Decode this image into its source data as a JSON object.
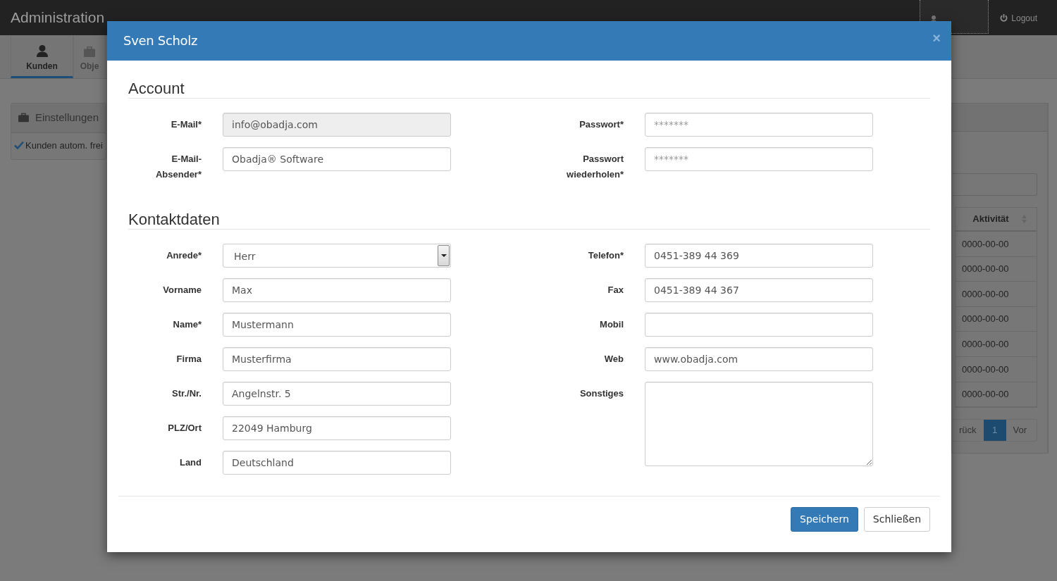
{
  "navbar": {
    "brand": "Administration",
    "logout": "Logout"
  },
  "tabs": [
    {
      "label": "Kunden",
      "selected": true
    },
    {
      "label": "Obje",
      "selected": false
    }
  ],
  "settings_panel": {
    "title": "Einstellungen",
    "options": [
      {
        "label": "Kunden autom. frei",
        "checked": true
      }
    ]
  },
  "table": {
    "columns": [
      "Aktivität"
    ],
    "rows": [
      [
        "0000-00-00"
      ],
      [
        "0000-00-00"
      ],
      [
        "0000-00-00"
      ],
      [
        "0000-00-00"
      ],
      [
        "0000-00-00"
      ],
      [
        "0000-00-00"
      ],
      [
        "0000-00-00"
      ]
    ]
  },
  "pagination": [
    {
      "label": "rück",
      "selected": false
    },
    {
      "label": "1",
      "selected": true
    },
    {
      "label": "Vor",
      "selected": false
    }
  ],
  "modal": {
    "title": "Sven Scholz",
    "close": "×",
    "sections": [
      {
        "title": "Account",
        "left": [
          {
            "label": "E-Mail*",
            "kind": "text",
            "value": "info@obadja.com",
            "disabled": true
          },
          {
            "label": "E-Mail-Absender*",
            "kind": "text",
            "value": "Obadja® Software",
            "disabled": false
          }
        ],
        "right": [
          {
            "label": "Passwort*",
            "kind": "password",
            "placeholder": "*******",
            "disabled": false
          },
          {
            "label": "Passwort wiederholen*",
            "kind": "password",
            "placeholder": "*******",
            "disabled": false
          }
        ]
      },
      {
        "title": "Kontaktdaten",
        "left": [
          {
            "label": "Anrede*",
            "kind": "select",
            "value": "Herr",
            "disabled": false
          },
          {
            "label": "Vorname",
            "kind": "text",
            "value": "Max",
            "disabled": false
          },
          {
            "label": "Name*",
            "kind": "text",
            "value": "Mustermann",
            "disabled": false
          },
          {
            "label": "Firma",
            "kind": "text",
            "value": "Musterfirma",
            "disabled": false
          },
          {
            "label": "Str./Nr.",
            "kind": "text",
            "value": "Angelnstr. 5",
            "disabled": false
          },
          {
            "label": "PLZ/Ort",
            "kind": "text",
            "value": "22049 Hamburg",
            "disabled": false
          },
          {
            "label": "Land",
            "kind": "text",
            "value": "Deutschland",
            "disabled": false
          }
        ],
        "right": [
          {
            "label": "Telefon*",
            "kind": "text",
            "value": "0451-389 44 369",
            "disabled": false
          },
          {
            "label": "Fax",
            "kind": "text",
            "value": "0451-389 44 367",
            "disabled": false
          },
          {
            "label": "Mobil",
            "kind": "text",
            "disabled": false
          },
          {
            "label": "Web",
            "kind": "text",
            "value": "www.obadja.com",
            "disabled": false
          },
          {
            "label": "Sonstiges",
            "kind": "textarea",
            "disabled": false
          }
        ]
      }
    ],
    "buttons": [
      {
        "label": "Speichern",
        "kind": "primary"
      },
      {
        "label": "Schließen",
        "kind": "default"
      }
    ]
  }
}
